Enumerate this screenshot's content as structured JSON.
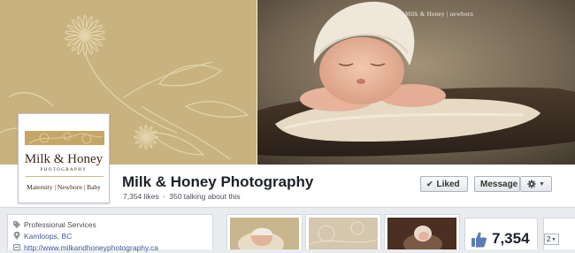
{
  "cover": {
    "watermark": "Milk & Honey | newborn"
  },
  "profile": {
    "logo_name": "Milk & Honey",
    "logo_sub": "PHOTOGRAPHY",
    "logo_tagline": "Maternity | Newborn | Baby"
  },
  "page": {
    "title": "Milk & Honey Photography",
    "likes_text": "7,354 likes",
    "separator": "·",
    "talking_text": "350 talking about this"
  },
  "actions": {
    "liked_label": "Liked",
    "liked_icon": "check-icon",
    "message_label": "Message",
    "settings_icon": "gear-icon"
  },
  "about": {
    "category": "Professional Services",
    "location": "Kamloops, BC",
    "website": "http://www.milkandhoneyphotography.ca"
  },
  "likes_box": {
    "count": "7,354"
  },
  "more": {
    "value": "2"
  },
  "colors": {
    "facebook_blue": "#3b5998",
    "cover_tan": "#c8b27f",
    "background": "#e9ebee"
  }
}
